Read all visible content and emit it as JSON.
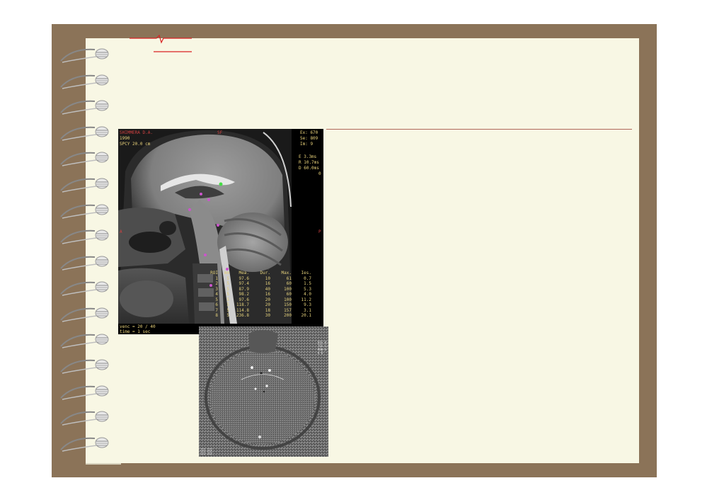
{
  "slide": {
    "frame_color": "#8b7358",
    "paper_color": "#f8f7e4",
    "accent_color": "#d92020",
    "divider_color": "#b0685a",
    "ring_count": 16
  },
  "sagittal_mri": {
    "patient_name": "SHIMMERA D.A.",
    "line2": "1990",
    "line3": "SPCY 20.0 cm",
    "orientation_top": "SF",
    "right_panel": [
      "Ex: 670",
      "Se: 809",
      "Im: 9"
    ],
    "right_panel2": [
      "E 3.3ms",
      "R 10.7ms",
      "D 60.0ms",
      "0"
    ],
    "left_marker": "A",
    "right_marker": "P",
    "roi_markers": [
      "1",
      "2",
      "3",
      "4",
      "5",
      "6",
      "7",
      "8"
    ],
    "roi_table": {
      "headers": [
        "ROI",
        "mm",
        "Mea.",
        "Dur.",
        "Max.",
        "Ies."
      ],
      "rows": [
        [
          "1",
          "5",
          "97.6",
          "10",
          "61",
          "0.7"
        ],
        [
          "2",
          "5",
          "97.4",
          "16",
          "60",
          "1.5"
        ],
        [
          "3",
          "5",
          "87.9",
          "40",
          "100",
          "5.3"
        ],
        [
          "4",
          "5",
          "98.2",
          "16",
          "60",
          "4.0"
        ],
        [
          "5",
          "5",
          "97.6",
          "20",
          "100",
          "11.2"
        ],
        [
          "6",
          "5",
          "118.7",
          "20",
          "150",
          "9.3"
        ],
        [
          "7",
          "5",
          "114.8",
          "18",
          "157",
          "3.1"
        ],
        [
          "8",
          "5",
          "236.8",
          "30",
          "200",
          "20.1"
        ]
      ]
    },
    "status_line1": "venc = 20 / 40",
    "status_line2": "time = 1 sec"
  },
  "axial_mri": {
    "top_right_info": "ESS 0.0\nTIE 1.0\nROW 6\nA 6",
    "bottom_left_info": "ZZZ ZZZ\nZZZ ZZZ"
  }
}
